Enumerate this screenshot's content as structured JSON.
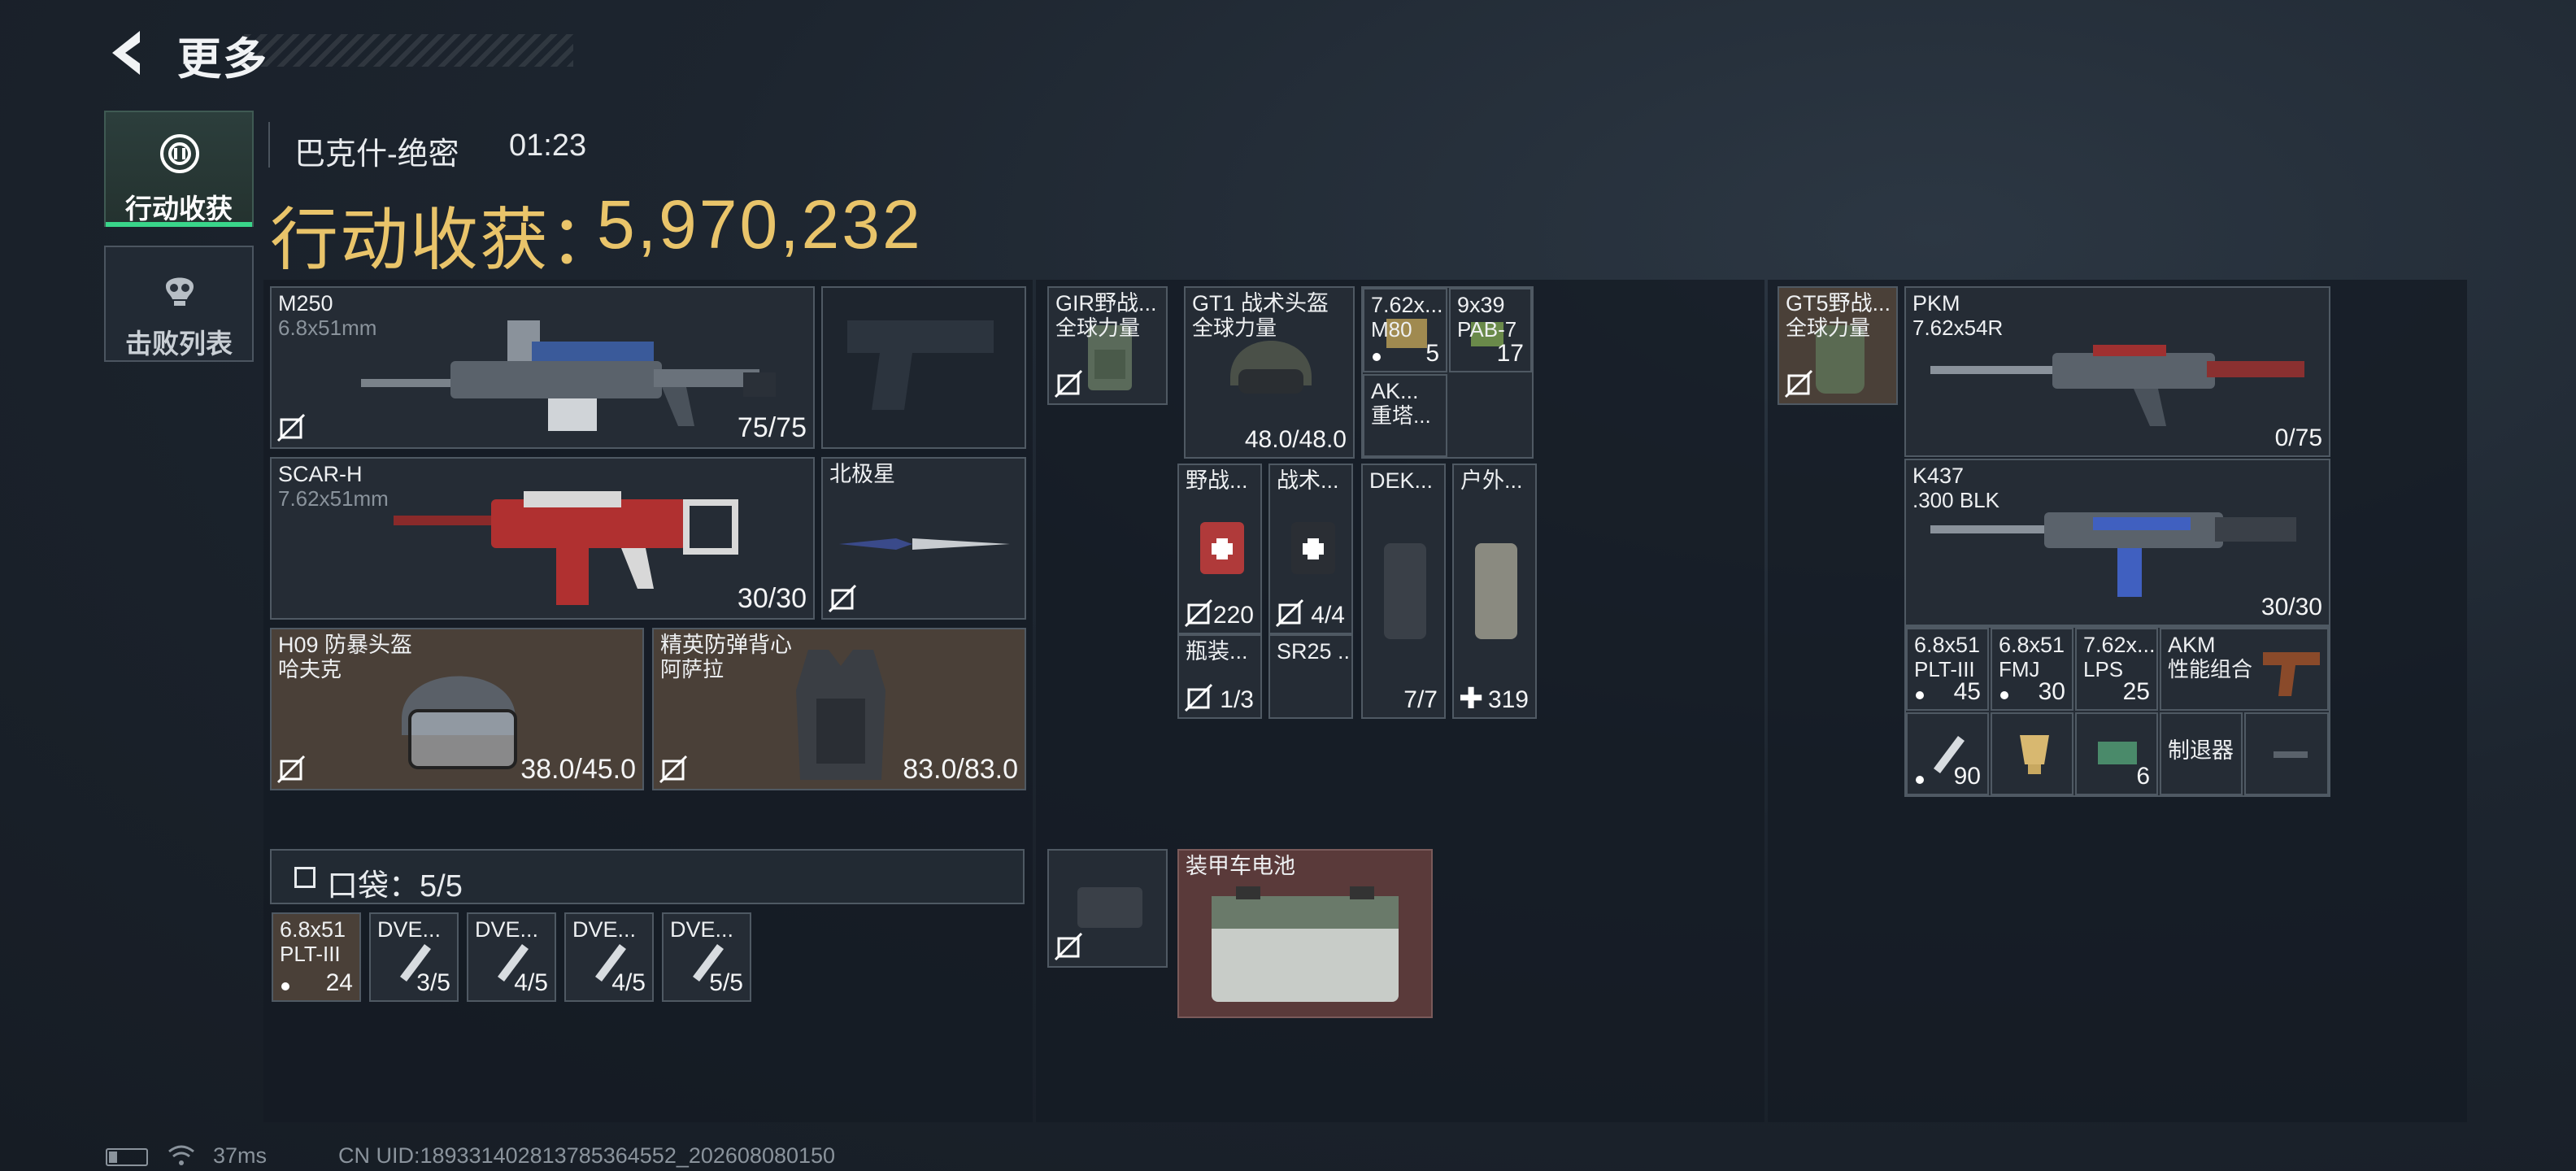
{
  "header": {
    "title": "更多"
  },
  "nav": {
    "loot_label": "行动收获",
    "kills_label": "击败列表"
  },
  "match": {
    "map": "巴克什-绝密",
    "duration": "01:23",
    "loot_label": "行动收获：",
    "loot_value": "5,970,232"
  },
  "colors": {
    "accent_gold": "#e9c46a",
    "active_green": "#39d58a",
    "panel": "#141b24"
  },
  "left_panel": {
    "primary1": {
      "name": "M250",
      "caliber": "6.8x51mm",
      "ammo": "75/75"
    },
    "primary2": {
      "name": "SCAR-H",
      "caliber": "7.62x51mm",
      "ammo": "30/30"
    },
    "melee": {
      "name": "北极星"
    },
    "helmet": {
      "name": "H09 防暴头盔",
      "sub": "哈夫克",
      "durability": "38.0/45.0"
    },
    "armor": {
      "name": "精英防弹背心",
      "sub": "阿萨拉",
      "durability": "83.0/83.0"
    },
    "pocket": {
      "label": "口袋：",
      "count": "5/5",
      "items": [
        {
          "name": "6.8x51",
          "sub": "PLT-III",
          "count": "24"
        },
        {
          "name": "DVE...",
          "count": "3/5"
        },
        {
          "name": "DVE...",
          "count": "4/5"
        },
        {
          "name": "DVE...",
          "count": "4/5"
        },
        {
          "name": "DVE...",
          "count": "5/5"
        }
      ]
    }
  },
  "mid_panel": {
    "rig": {
      "name": "GIR野战...",
      "sub": "全球力量"
    },
    "headset": {
      "name": "GT1 战术头盔",
      "sub": "全球力量",
      "durability": "48.0/48.0"
    },
    "ammo1": {
      "name": "7.62x...",
      "sub": "M80",
      "count": "5"
    },
    "ammo2": {
      "name": "9x39",
      "sub": "PAB-7",
      "count": "17"
    },
    "mag": {
      "name": "AK...",
      "sub": "重塔..."
    },
    "med1": {
      "name": "野战...",
      "count": "220"
    },
    "med2": {
      "name": "战术...",
      "count": "4/4"
    },
    "med3": {
      "name": "DEK...",
      "count": "7/7"
    },
    "med4": {
      "name": "户外...",
      "count": "319"
    },
    "bottle": {
      "name": "瓶装...",
      "count": "1/3"
    },
    "sr25": {
      "name": "SR25 ..."
    },
    "battery": {
      "name": "装甲车电池"
    }
  },
  "right_panel": {
    "backpack": {
      "name": "GT5野战...",
      "sub": "全球力量"
    },
    "weapon1": {
      "name": "PKM",
      "caliber": "7.62x54R",
      "ammo": "0/75"
    },
    "weapon2": {
      "name": "K437",
      "caliber": ".300 BLK",
      "ammo": "30/30"
    },
    "grid": [
      {
        "name": "6.8x51",
        "sub": "PLT-III",
        "count": "45"
      },
      {
        "name": "6.8x51",
        "sub": "FMJ",
        "count": "30"
      },
      {
        "name": "7.62x...",
        "sub": "LPS",
        "count": "25"
      },
      {
        "name": "AKM",
        "sub": "性能组合"
      },
      {
        "count": "90"
      },
      {
        "count": ""
      },
      {
        "count": "6"
      },
      {
        "name": "制退器"
      },
      {
        "name": ""
      }
    ]
  },
  "status": {
    "ping": "37ms",
    "uid": "CN UID:189331402813785364552_202608080150"
  }
}
